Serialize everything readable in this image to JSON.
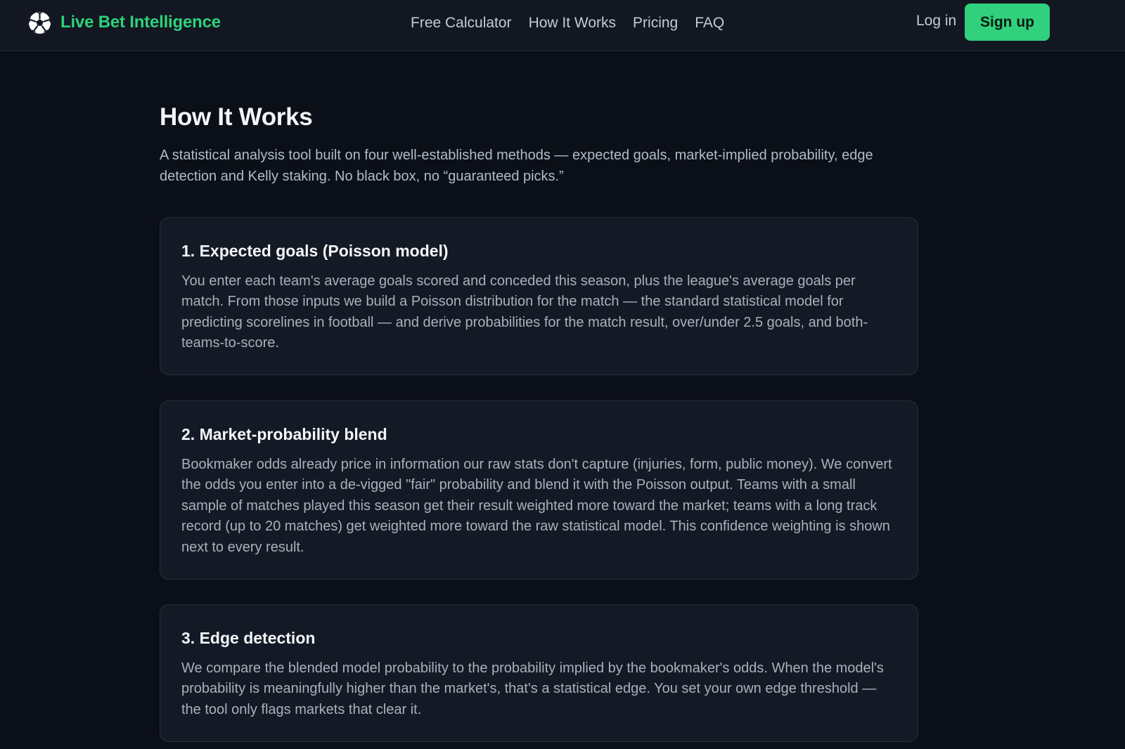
{
  "header": {
    "brand_name": "Live Bet Intelligence",
    "brand_icon": "soccer-ball-icon",
    "nav": [
      {
        "label": "Free Calculator"
      },
      {
        "label": "How It Works"
      },
      {
        "label": "Pricing"
      },
      {
        "label": "FAQ"
      }
    ],
    "login_label": "Log in",
    "signup_label": "Sign up"
  },
  "page": {
    "title": "How It Works",
    "intro": "A statistical analysis tool built on four well-established methods — expected goals, market-implied probability, edge detection and Kelly staking. No black box, no “guaranteed picks.”"
  },
  "sections": [
    {
      "title": "1. Expected goals (Poisson model)",
      "body": "You enter each team's average goals scored and conceded this season, plus the league's average goals per match. From those inputs we build a Poisson distribution for the match — the standard statistical model for predicting scorelines in football — and derive probabilities for the match result, over/under 2.5 goals, and both-teams-to-score."
    },
    {
      "title": "2. Market-probability blend",
      "body": "Bookmaker odds already price in information our raw stats don't capture (injuries, form, public money). We convert the odds you enter into a de-vigged \"fair\" probability and blend it with the Poisson output. Teams with a small sample of matches played this season get their result weighted more toward the market; teams with a long track record (up to 20 matches) get weighted more toward the raw statistical model. This confidence weighting is shown next to every result."
    },
    {
      "title": "3. Edge detection",
      "body": "We compare the blended model probability to the probability implied by the bookmaker's odds. When the model's probability is meaningfully higher than the market's, that's a statistical edge. You set your own edge threshold — the tool only flags markets that clear it."
    }
  ],
  "colors": {
    "background": "#0b0f17",
    "header_bg": "#121722",
    "card_bg": "#141a25",
    "accent": "#30d07c"
  }
}
